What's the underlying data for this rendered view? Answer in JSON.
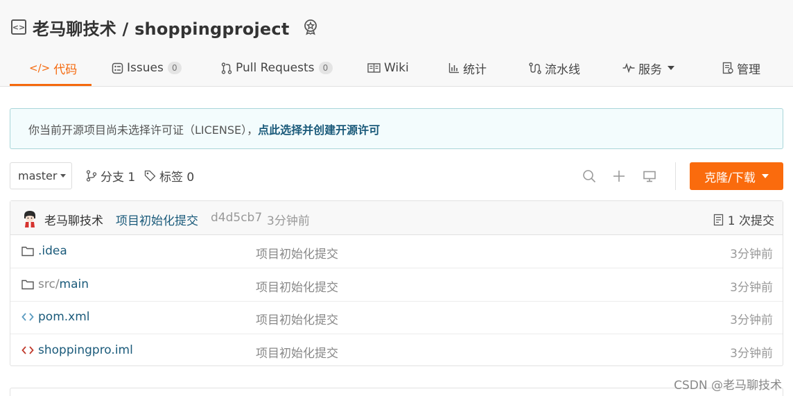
{
  "repo": {
    "icon": "code-box-icon",
    "title": "老马聊技术 / shoppingproject",
    "badge_icon": "award-badge-icon"
  },
  "tabs": [
    {
      "label": "代码",
      "icon": "code-icon",
      "active": true
    },
    {
      "label": "Issues",
      "icon": "issues-icon",
      "count": "0"
    },
    {
      "label": "Pull Requests",
      "icon": "pull-request-icon",
      "count": "0"
    },
    {
      "label": "Wiki",
      "icon": "book-icon"
    },
    {
      "label": "统计",
      "icon": "bar-chart-icon"
    },
    {
      "label": "流水线",
      "icon": "pipeline-icon"
    },
    {
      "label": "服务",
      "icon": "pulse-icon",
      "dropdown": true
    },
    {
      "label": "管理",
      "icon": "manage-icon"
    }
  ],
  "notice": {
    "text": "你当前开源项目尚未选择许可证（LICENSE），",
    "link": "点此选择并创建开源许可"
  },
  "toolbar": {
    "branch": "master",
    "branches_label": "分支 1",
    "tags_label": "标签 0",
    "clone_label": "克隆/下载"
  },
  "latest_commit": {
    "author": "老马聊技术",
    "message": "项目初始化提交",
    "sha": "d4d5cb7",
    "time": "3分钟前",
    "count_label": "1 次提交"
  },
  "files": [
    {
      "type": "folder",
      "name": ".idea",
      "prefix": "",
      "message": "项目初始化提交",
      "time": "3分钟前",
      "icon": "folder-icon"
    },
    {
      "type": "folder",
      "name": "main",
      "prefix": "src/",
      "message": "项目初始化提交",
      "time": "3分钟前",
      "icon": "folder-icon"
    },
    {
      "type": "code",
      "name": "pom.xml",
      "prefix": "",
      "message": "项目初始化提交",
      "time": "3分钟前",
      "icon": "code-file-icon"
    },
    {
      "type": "code",
      "name": "shoppingpro.iml",
      "prefix": "",
      "message": "项目初始化提交",
      "time": "3分钟前",
      "icon": "code-file-icon"
    }
  ],
  "watermark": "CSDN @老马聊技术",
  "colors": {
    "accent": "#f5690d",
    "link": "#1a5a7a",
    "notice_bg": "#f3fcfd",
    "notice_border": "#a9d6d9"
  }
}
